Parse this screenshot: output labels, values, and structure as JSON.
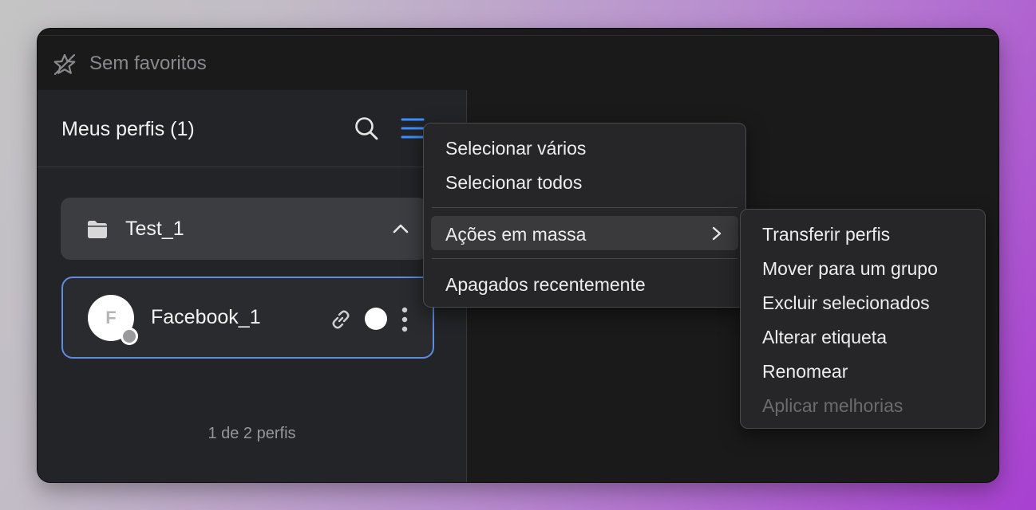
{
  "favorites": {
    "label": "Sem favoritos",
    "icon": "star-slash-icon"
  },
  "sidebar": {
    "title": "Meus perfis (1)",
    "search_icon": "search-icon",
    "menu_icon": "list-menu-icon",
    "group": {
      "name": "Test_1",
      "icon": "folder-icon",
      "expanded": true
    },
    "profile": {
      "avatar_letter": "F",
      "name": "Facebook_1",
      "link_icon": "link-icon",
      "status_icon": "status-dot-icon",
      "more_icon": "kebab-icon"
    },
    "count_text": "1 de 2 perfis"
  },
  "menu": {
    "items": [
      {
        "label": "Selecionar vários"
      },
      {
        "label": "Selecionar todos"
      },
      {
        "label": "Ações em massa",
        "has_submenu": true,
        "active": true
      },
      {
        "label": "Apagados recentemente"
      }
    ]
  },
  "submenu": {
    "items": [
      {
        "label": "Transferir perfis"
      },
      {
        "label": "Mover para um grupo"
      },
      {
        "label": "Excluir selecionados"
      },
      {
        "label": "Alterar etiqueta"
      },
      {
        "label": "Renomear"
      },
      {
        "label": "Aplicar melhorias",
        "disabled": true
      }
    ]
  },
  "colors": {
    "accent": "#5e8ce0",
    "menu_icon": "#3d8eff",
    "window_bg": "#1a1a1b",
    "sidebar_bg": "#232427"
  }
}
